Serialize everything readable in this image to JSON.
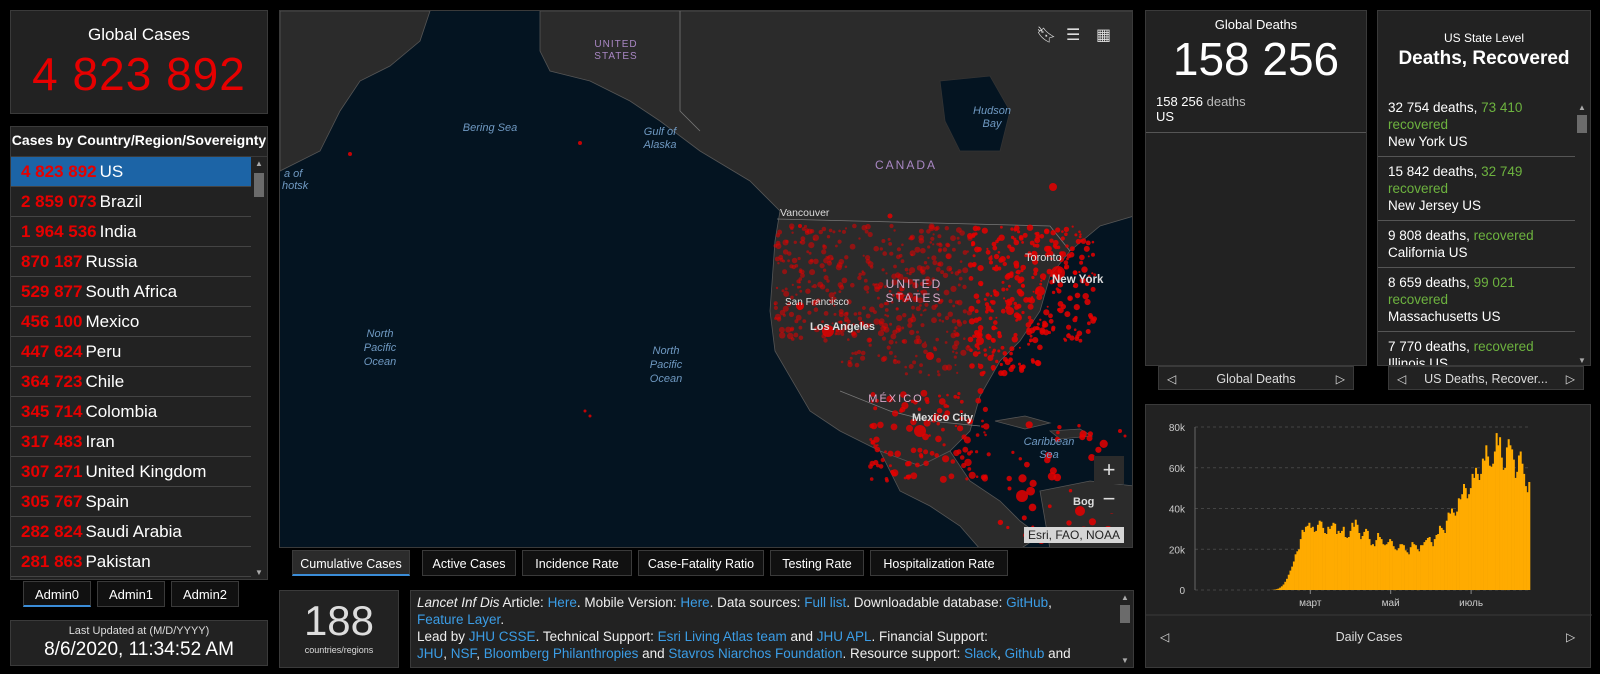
{
  "global_cases": {
    "label": "Global Cases",
    "value": "4 823 892"
  },
  "country_list": {
    "header": "Cases by Country/Region/Sovereignty",
    "items": [
      {
        "count": "4 823 892",
        "name": "US"
      },
      {
        "count": "2 859 073",
        "name": "Brazil"
      },
      {
        "count": "1 964 536",
        "name": "India"
      },
      {
        "count": "870 187",
        "name": "Russia"
      },
      {
        "count": "529 877",
        "name": "South Africa"
      },
      {
        "count": "456 100",
        "name": "Mexico"
      },
      {
        "count": "447 624",
        "name": "Peru"
      },
      {
        "count": "364 723",
        "name": "Chile"
      },
      {
        "count": "345 714",
        "name": "Colombia"
      },
      {
        "count": "317 483",
        "name": "Iran"
      },
      {
        "count": "307 271",
        "name": "United Kingdom"
      },
      {
        "count": "305 767",
        "name": "Spain"
      },
      {
        "count": "282 824",
        "name": "Saudi Arabia"
      },
      {
        "count": "281 863",
        "name": "Pakistan"
      }
    ]
  },
  "admin_tabs": [
    "Admin0",
    "Admin1",
    "Admin2"
  ],
  "last_updated": {
    "label": "Last Updated at (M/D/YYYY)",
    "value": "8/6/2020, 11:34:52 AM"
  },
  "map": {
    "labels": {
      "united_states_top": [
        "UNITED",
        "STATES"
      ],
      "bering_sea": "Bering Sea",
      "gulf_alaska": [
        "Gulf of",
        "Alaska"
      ],
      "hudson_bay": [
        "Hudson",
        "Bay"
      ],
      "canada": "CANADA",
      "okhotsk": [
        "a of",
        "hotsk"
      ],
      "vancouver": "Vancouver",
      "toronto": "Toronto",
      "new_york": "New York",
      "united_states": [
        "UNITED",
        "STATES"
      ],
      "san_francisco": "San Francisco",
      "los_angeles": "Los Angeles",
      "north_pacific_left": [
        "North",
        "Pacific",
        "Ocean"
      ],
      "north_pacific_mid": [
        "North",
        "Pacific",
        "Ocean"
      ],
      "mexico": "MÉXICO",
      "mexico_city": "Mexico City",
      "caribbean": [
        "Caribbean",
        "Sea"
      ],
      "bogota": "Bogo"
    },
    "zoom_in": "+",
    "zoom_out": "−",
    "attribution": "Esri, FAO, NOAA"
  },
  "map_tabs": [
    "Cumulative Cases",
    "Active Cases",
    "Incidence Rate",
    "Case-Fatality Ratio",
    "Testing Rate",
    "Hospitalization Rate"
  ],
  "countries_count": {
    "value": "188",
    "label": "countries/regions"
  },
  "info": {
    "l1a": "Lancet Inf Dis",
    "l1b": " Article: ",
    "l1c": "Here",
    "l1d": ". Mobile Version: ",
    "l1e": "Here",
    "l1f": ". Data sources: ",
    "l1g": "Full list",
    "l1h": ". Downloadable database: ",
    "l1i": "GitHub",
    "l1j": ",",
    "l2a": "Feature Layer",
    "l2b": ".",
    "l3a": "Lead by ",
    "l3b": "JHU CSSE",
    "l3c": ". Technical Support: ",
    "l3d": "Esri Living Atlas team",
    "l3e": " and ",
    "l3f": "JHU APL",
    "l3g": ". Financial Support:",
    "l4a": "JHU",
    "l4b": ", ",
    "l4c": "NSF",
    "l4d": ", ",
    "l4e": "Bloomberg Philanthropies",
    "l4f": " and ",
    "l4g": "Stavros Niarchos Foundation",
    "l4h": ". Resource support: ",
    "l4i": "Slack",
    "l4j": ", ",
    "l4k": "Github",
    "l4l": " and"
  },
  "global_deaths": {
    "label": "Global Deaths",
    "value": "158 256",
    "detail_count": "158 256",
    "detail_suffix": " deaths",
    "detail_country": "US",
    "pager_label": "Global Deaths"
  },
  "us_state": {
    "label": "US State Level",
    "title": "Deaths, Recovered",
    "items": [
      {
        "deaths": "32 754 deaths,",
        "recovered_count": "73 410",
        "recovered_word": "recovered",
        "state": "New York US"
      },
      {
        "deaths": "15 842 deaths,",
        "recovered_count": "32 749",
        "recovered_word": "recovered",
        "state": "New Jersey US"
      },
      {
        "deaths": "9 808 deaths,",
        "recovered_count": "",
        "recovered_word": "recovered",
        "state": "California US"
      },
      {
        "deaths": "8 659 deaths,",
        "recovered_count": "99 021",
        "recovered_word": "recovered",
        "state": "Massachusetts US"
      },
      {
        "deaths": "7 770 deaths,",
        "recovered_count": "",
        "recovered_word": "recovered",
        "state": "Illinois US"
      }
    ],
    "pager_label": "US Deaths, Recover..."
  },
  "colors": {
    "case_red": "#e60000",
    "recovered_green": "#6db33f",
    "link_blue": "#3b9de6",
    "bar_orange": "#ffab00",
    "map_ocean": "#041421",
    "selected_row": "#1c64a6"
  },
  "chart_data": {
    "type": "bar",
    "title": "Daily Cases",
    "xlabel": "",
    "ylabel": "",
    "x_tick_labels": [
      "март",
      "май",
      "июль"
    ],
    "y_tick_labels": [
      "0",
      "20k",
      "40k",
      "60k",
      "80k"
    ],
    "ylim": [
      0,
      80000
    ],
    "grid": true,
    "series": [
      {
        "values": [
          0,
          0,
          0,
          0,
          0,
          0,
          0,
          0,
          0,
          0,
          0,
          0,
          0,
          0,
          0,
          0,
          0,
          0,
          0,
          0,
          0,
          0,
          0,
          0,
          0,
          0,
          0,
          0,
          0,
          0,
          0,
          0,
          0,
          0,
          0,
          0,
          0,
          0,
          0,
          0,
          0,
          0,
          0,
          10,
          50,
          100,
          200,
          400,
          700,
          1200,
          1800,
          2700,
          4000,
          5500,
          7500,
          9500,
          11500,
          14000,
          17500,
          19000,
          20000,
          25000,
          29500,
          28500,
          31000,
          31500,
          33000,
          30500,
          31000,
          28500,
          29000,
          32000,
          34000,
          33500,
          30500,
          28000,
          27500,
          31000,
          30000,
          31500,
          33000,
          32500,
          27500,
          29000,
          28000,
          29000,
          31000,
          26000,
          25500,
          26000,
          29000,
          33000,
          31000,
          34500,
          32000,
          28000,
          25000,
          26500,
          28500,
          30000,
          29000,
          25000,
          22000,
          22500,
          21500,
          24500,
          28000,
          26000,
          25000,
          22500,
          22000,
          22500,
          23500,
          25000,
          24000,
          21500,
          20000,
          19500,
          20500,
          22500,
          22500,
          22000,
          19500,
          18500,
          17500,
          21000,
          23500,
          22500,
          22000,
          20000,
          19000,
          22000,
          22000,
          23500,
          24500,
          25500,
          26000,
          23500,
          21500,
          25000,
          27000,
          27500,
          31500,
          30500,
          29500,
          28000,
          34000,
          38000,
          37500,
          40000,
          38000,
          36500,
          38500,
          45000,
          44500,
          47000,
          52000,
          50000,
          45000,
          47000,
          50000,
          57000,
          55000,
          60000,
          57000,
          54000,
          57000,
          64500,
          63500,
          71000,
          65500,
          61000,
          60500,
          62000,
          68000,
          77000,
          71000,
          75000,
          65000,
          59000,
          60000,
          70000,
          74000,
          71000,
          69000,
          64000,
          55000,
          58000,
          66000,
          68000,
          62000,
          57000,
          51000,
          48000,
          53000
        ]
      }
    ]
  }
}
